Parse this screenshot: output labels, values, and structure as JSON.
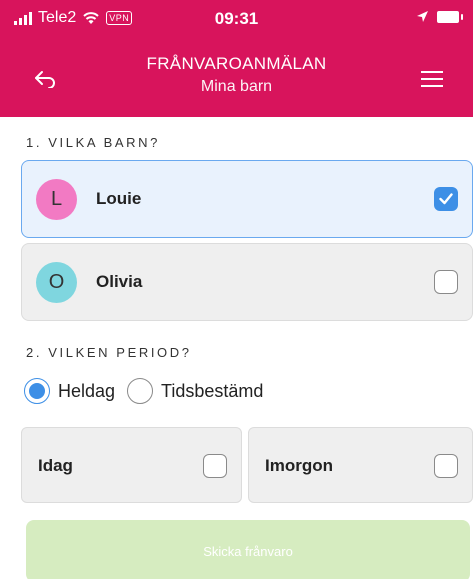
{
  "status_bar": {
    "carrier": "Tele2",
    "vpn": "VPN",
    "time": "09:31"
  },
  "header": {
    "title": "FRÅNVAROANMÄLAN",
    "subtitle": "Mina barn"
  },
  "section1": {
    "label": "1. VILKA BARN?",
    "children": [
      {
        "initial": "L",
        "name": "Louie",
        "selected": true,
        "avatar_color": "#f27ac3"
      },
      {
        "initial": "O",
        "name": "Olivia",
        "selected": false,
        "avatar_color": "#7fd6df"
      }
    ]
  },
  "section2": {
    "label": "2. VILKEN PERIOD?",
    "period_options": [
      {
        "label": "Heldag",
        "selected": true
      },
      {
        "label": "Tidsbestämd",
        "selected": false
      }
    ],
    "days": [
      {
        "label": "Idag",
        "checked": false
      },
      {
        "label": "Imorgon",
        "checked": false
      }
    ]
  },
  "submit": {
    "label": "Skicka frånvaro"
  },
  "colors": {
    "brand": "#d8145c",
    "accent": "#3d8fe6",
    "submit_disabled": "#d6ecc0"
  },
  "icons": {
    "back": "back-arrow-icon",
    "menu": "hamburger-menu-icon",
    "check": "checkmark-icon"
  }
}
